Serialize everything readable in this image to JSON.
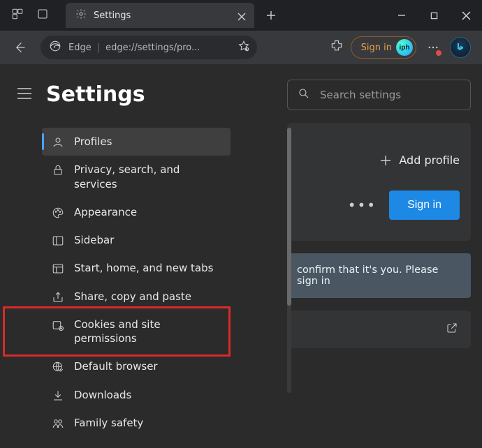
{
  "window": {
    "tab_title": "Settings"
  },
  "toolbar": {
    "product": "Edge",
    "url": "edge://settings/pro...",
    "sign_in": "Sign in",
    "avatar_text": "iph"
  },
  "settings_header": {
    "title": "Settings"
  },
  "nav": {
    "items": [
      {
        "label": "Profiles",
        "icon": "profile-icon"
      },
      {
        "label": "Privacy, search, and services",
        "icon": "lock-icon"
      },
      {
        "label": "Appearance",
        "icon": "palette-icon"
      },
      {
        "label": "Sidebar",
        "icon": "sidebar-icon"
      },
      {
        "label": "Start, home, and new tabs",
        "icon": "layout-icon"
      },
      {
        "label": "Share, copy and paste",
        "icon": "share-icon"
      },
      {
        "label": "Cookies and site permissions",
        "icon": "cookies-icon"
      },
      {
        "label": "Default browser",
        "icon": "globe-check-icon"
      },
      {
        "label": "Downloads",
        "icon": "download-icon"
      },
      {
        "label": "Family safety",
        "icon": "family-icon"
      }
    ],
    "active_index": 0,
    "highlighted_index": 6
  },
  "right": {
    "search_placeholder": "Search settings",
    "add_profile": "Add profile",
    "sign_in_button": "Sign in",
    "confirm_text": "confirm that it's you. Please sign in"
  },
  "colors": {
    "accent": "#1e88e5",
    "highlight": "#d82a2a",
    "sign_in_text": "#e7a14a"
  }
}
